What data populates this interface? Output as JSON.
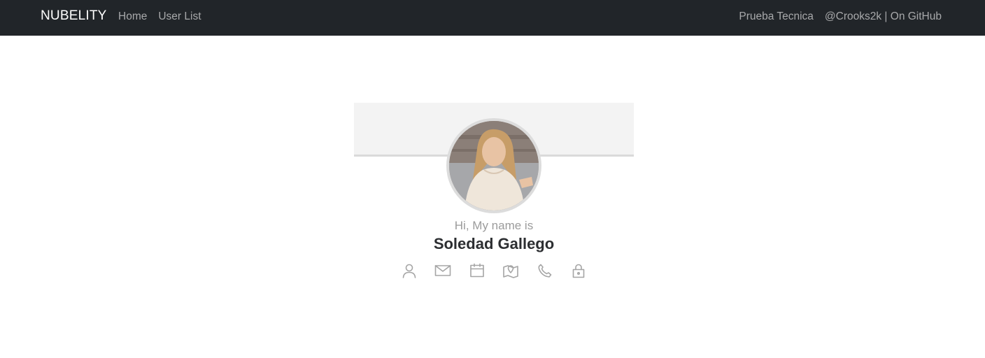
{
  "navbar": {
    "brand": "NUBELITY",
    "left_links": [
      "Home",
      "User List"
    ],
    "right_links": [
      "Prueba Tecnica",
      "@Crooks2k | On GitHub"
    ]
  },
  "profile": {
    "intro": "Hi, My name is",
    "name": "Soledad Gallego",
    "icons": [
      "user-icon",
      "mail-icon",
      "calendar-icon",
      "map-icon",
      "phone-icon",
      "lock-icon"
    ]
  },
  "colors": {
    "navbar_bg": "#212529",
    "card_header_bg": "#f3f3f3",
    "icon_color": "#a5a5a5"
  }
}
